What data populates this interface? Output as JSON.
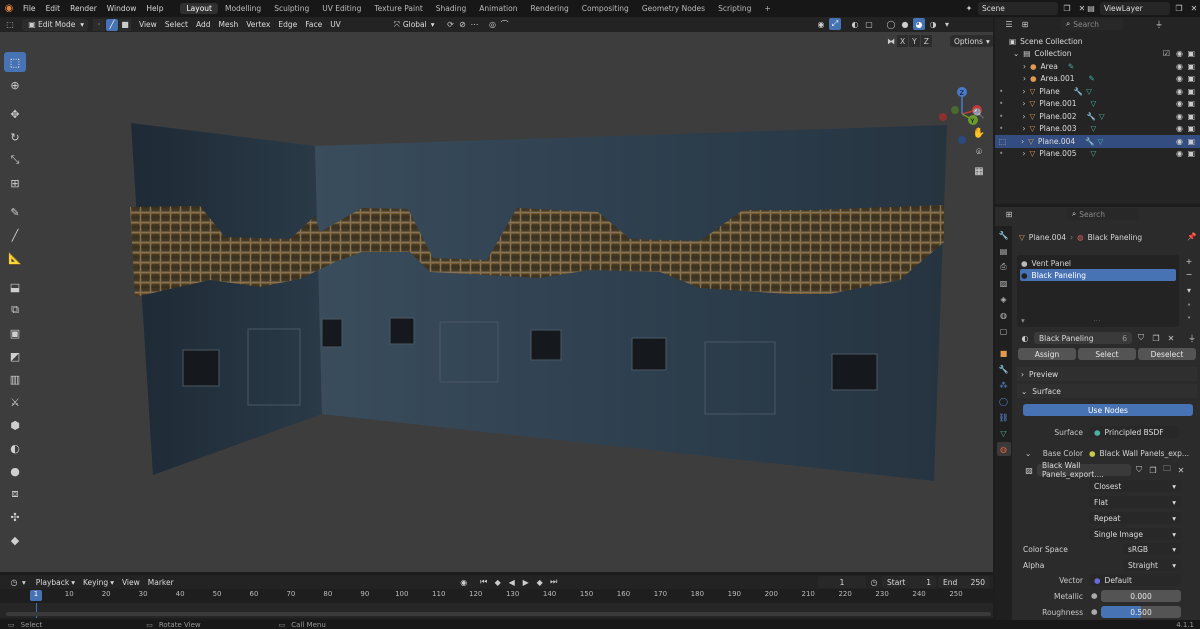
{
  "topbar": {
    "menus": [
      "File",
      "Edit",
      "Render",
      "Window",
      "Help"
    ],
    "workspaces": [
      "Layout",
      "Modelling",
      "Sculpting",
      "UV Editing",
      "Texture Paint",
      "Shading",
      "Animation",
      "Rendering",
      "Compositing",
      "Geometry Nodes",
      "Scripting"
    ],
    "add": "+",
    "scene": "Scene",
    "viewlayer": "ViewLayer"
  },
  "viewport_header": {
    "mode": "Edit Mode",
    "menus": [
      "View",
      "Select",
      "Add",
      "Mesh",
      "Vertex",
      "Edge",
      "Face",
      "UV"
    ],
    "orientation": "Global",
    "axes": [
      "X",
      "Y",
      "Z"
    ],
    "options": "Options"
  },
  "gizmo": {
    "x": "X",
    "y": "Y",
    "z": "Z"
  },
  "outliner": {
    "search_placeholder": "Search",
    "root": "Scene Collection",
    "collection": "Collection",
    "items": [
      "Area",
      "Area.001",
      "Plane",
      "Plane.001",
      "Plane.002",
      "Plane.003",
      "Plane.004",
      "Plane.005"
    ]
  },
  "properties": {
    "search_placeholder": "Search",
    "object": "Plane.004",
    "material_path": "Black Paneling",
    "slots": [
      "Vent Panel",
      "Black Paneling"
    ],
    "material_name": "Black Paneling",
    "users": "6",
    "assign": "Assign",
    "select": "Select",
    "deselect": "Deselect",
    "preview": "Preview",
    "surface_section": "Surface",
    "use_nodes": "Use Nodes",
    "surface_label": "Surface",
    "surface_value": "Principled BSDF",
    "base_color_label": "Base Color",
    "base_color_value": "Black Wall Panels_exp...",
    "image_name": "Black Wall Panels_export....",
    "interp": "Closest",
    "proj": "Flat",
    "ext": "Repeat",
    "source": "Single Image",
    "colorspace_label": "Color Space",
    "colorspace": "sRGB",
    "alpha_label": "Alpha",
    "alpha": "Straight",
    "vector_label": "Vector",
    "vector": "Default",
    "metallic_label": "Metallic",
    "metallic": "0.000",
    "roughness_label": "Roughness",
    "roughness": "0.500"
  },
  "timeline": {
    "playback": "Playback",
    "keying": "Keying",
    "view": "View",
    "marker": "Marker",
    "current": "1",
    "start_label": "Start",
    "start": "1",
    "end_label": "End",
    "end": "250",
    "ticks": [
      "1",
      "10",
      "20",
      "30",
      "40",
      "50",
      "60",
      "70",
      "80",
      "90",
      "100",
      "110",
      "120",
      "130",
      "140",
      "150",
      "160",
      "170",
      "180",
      "190",
      "200",
      "210",
      "220",
      "230",
      "240",
      "250"
    ]
  },
  "status": {
    "select": "Select",
    "rotate": "Rotate View",
    "call_menu": "Call Menu",
    "version": "4.1.1"
  }
}
